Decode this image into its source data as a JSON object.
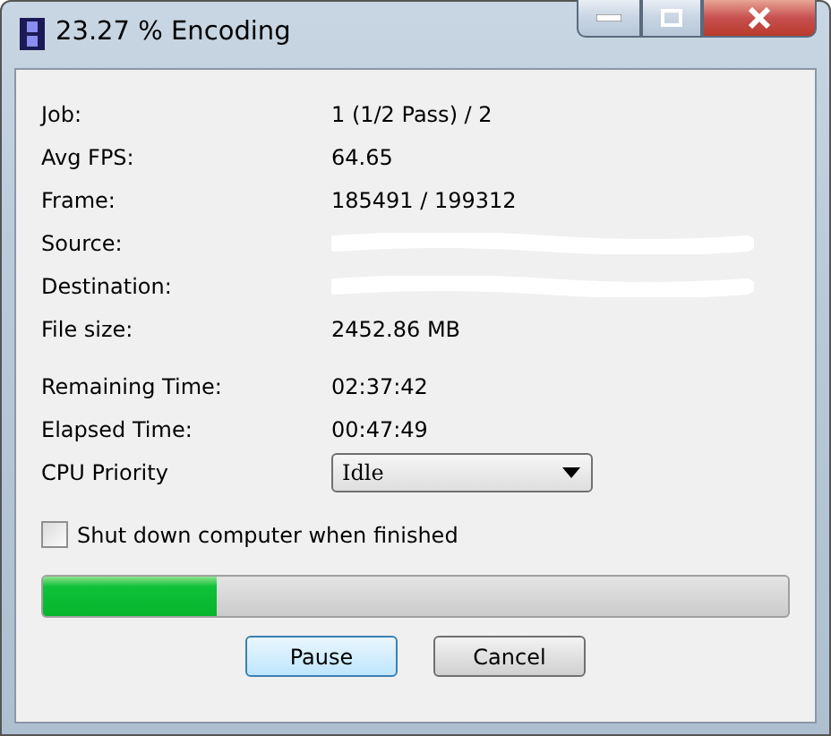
{
  "window": {
    "title": "23.27 % Encoding"
  },
  "fields": [
    {
      "label": "Job:",
      "value": "1 (1/2 Pass) / 2"
    },
    {
      "label": "Avg FPS:",
      "value": "64.65"
    },
    {
      "label": "Frame:",
      "value": "185491 / 199312"
    },
    {
      "label": "Source:",
      "kind": "redacted"
    },
    {
      "label": "Destination:",
      "kind": "redacted"
    },
    {
      "label": "File size:",
      "value": "2452.86 MB"
    }
  ],
  "times": [
    {
      "label": "Remaining Time:",
      "value": "02:37:42"
    },
    {
      "label": "Elapsed Time:",
      "value": "00:47:49"
    }
  ],
  "cpu_priority": {
    "label": "CPU Priority",
    "value": "Idle"
  },
  "shutdown": {
    "label": "Shut down computer when finished",
    "checked": false
  },
  "progress": {
    "level": 0.2327
  },
  "buttons": [
    {
      "label": "Pause",
      "selected": true
    },
    {
      "label": "Cancel",
      "selected": false
    }
  ]
}
